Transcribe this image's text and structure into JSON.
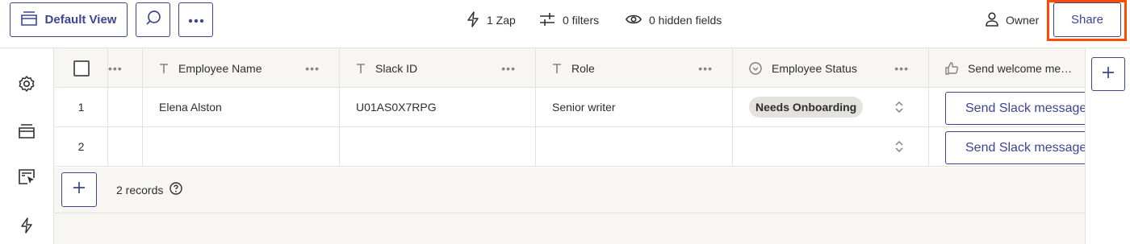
{
  "toolbar": {
    "view_label": "Default View",
    "zap_label": "1 Zap",
    "filters_label": "0 filters",
    "hidden_label": "0 hidden fields",
    "owner_label": "Owner",
    "share_label": "Share"
  },
  "table": {
    "columns": [
      {
        "label": "Employee Name",
        "icon": "text-type-icon"
      },
      {
        "label": "Slack ID",
        "icon": "text-type-icon"
      },
      {
        "label": "Role",
        "icon": "text-type-icon"
      },
      {
        "label": "Employee Status",
        "icon": "status-circle-icon"
      },
      {
        "label": "Send welcome me…",
        "icon": "thumbs-up-icon"
      }
    ],
    "rows": [
      {
        "num": "1",
        "name": "Elena Alston",
        "slack_id": "U01AS0X7RPG",
        "role": "Senior writer",
        "status": "Needs Onboarding",
        "action": "Send Slack message"
      },
      {
        "num": "2",
        "name": "",
        "slack_id": "",
        "role": "",
        "status": "",
        "action": "Send Slack message"
      }
    ]
  },
  "footer": {
    "records_label": "2 records"
  },
  "colors": {
    "accent": "#3d4592",
    "highlight": "#ff4a00"
  }
}
